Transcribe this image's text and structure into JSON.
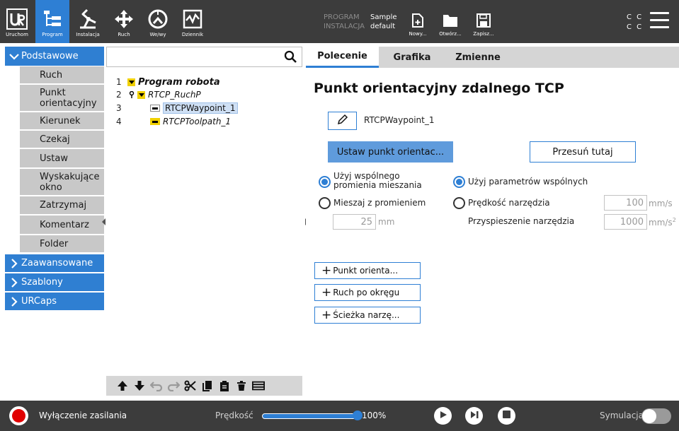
{
  "topbar": {
    "nav": [
      {
        "id": "run",
        "label": "Uruchom"
      },
      {
        "id": "program",
        "label": "Program"
      },
      {
        "id": "install",
        "label": "Instalacja"
      },
      {
        "id": "move",
        "label": "Ruch"
      },
      {
        "id": "io",
        "label": "We/wy"
      },
      {
        "id": "log",
        "label": "Dziennik"
      }
    ],
    "program_label": "PROGRAM",
    "program_value": "Sample",
    "install_label": "INSTALACJA",
    "install_value": "default",
    "file_buttons": [
      {
        "id": "new",
        "label": "Nowy..."
      },
      {
        "id": "open",
        "label": "Otwórz..."
      },
      {
        "id": "save",
        "label": "Zapisz..."
      }
    ],
    "cc_line1": "C C",
    "cc_line2": "C C",
    "colors": {
      "bar": "#3c3c3c",
      "active": "#2e7fd4"
    }
  },
  "sidebar": {
    "basic_category": "Podstawowe",
    "basic_items": [
      "Ruch",
      "Punkt orientacyjny",
      "Kierunek",
      "Czekaj",
      "Ustaw",
      "Wyskakujące okno",
      "Zatrzymaj",
      "Komentarz",
      "Folder"
    ],
    "advanced_category": "Zaawansowane",
    "templates_category": "Szablony",
    "urcaps_category": "URCaps"
  },
  "tree": {
    "rows": [
      {
        "num": "1",
        "label": "Program robota"
      },
      {
        "num": "2",
        "label": "RTCP_RuchP"
      },
      {
        "num": "3",
        "label": "RTCPWaypoint_1"
      },
      {
        "num": "4",
        "label": "RTCPToolpath_1"
      }
    ]
  },
  "tabs": [
    "Polecenie",
    "Grafika",
    "Zmienne"
  ],
  "command": {
    "title": "Punkt orientacyjny zdalnego TCP",
    "waypoint_name": "RTCPWaypoint_1",
    "set_button": "Ustaw punkt orientac...",
    "move_here_button": "Przesuń tutaj",
    "shared_blend_line1": "Użyj wspólnego",
    "shared_blend_line2": "promienia mieszania",
    "blend_radius": "Mieszaj z promieniem",
    "blend_value": "25",
    "blend_unit": "mm",
    "shared_params": "Użyj parametrów wspólnych",
    "tool_speed": "Prędkość narzędzia",
    "tool_speed_value": "100",
    "tool_speed_unit": "mm/s",
    "tool_accel": "Przyspieszenie narzędzia",
    "tool_accel_value": "1000",
    "tool_accel_unit": "mm/s",
    "tool_accel_unit_exp": "2",
    "add_buttons": [
      "Punkt orienta...",
      "Ruch po okręgu",
      "Ścieżka narzę..."
    ]
  },
  "bottombar": {
    "power_label": "Wyłączenie zasilania",
    "speed_label": "Prędkość",
    "speed_value": "100%",
    "speed_fraction": 1.0,
    "sim_label": "Symulacja"
  }
}
